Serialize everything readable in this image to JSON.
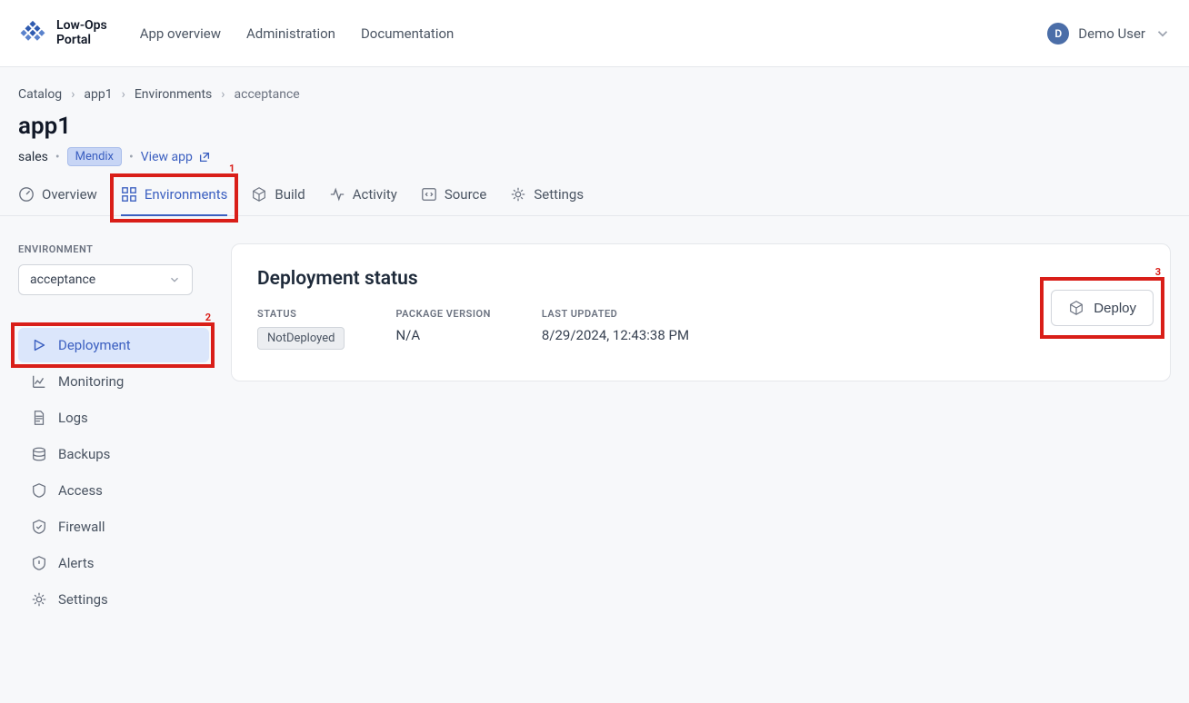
{
  "header": {
    "logo_line1": "Low-Ops",
    "logo_line2": "Portal",
    "nav": [
      "App overview",
      "Administration",
      "Documentation"
    ],
    "user_initial": "D",
    "user_name": "Demo User"
  },
  "breadcrumb": [
    "Catalog",
    "app1",
    "Environments",
    "acceptance"
  ],
  "page_title": "app1",
  "subline": {
    "team": "sales",
    "badge": "Mendix",
    "view_app": "View app"
  },
  "tabs": [
    "Overview",
    "Environments",
    "Build",
    "Activity",
    "Source",
    "Settings"
  ],
  "annotations": {
    "tab": "1",
    "side": "2",
    "deploy": "3"
  },
  "sidebar": {
    "label": "ENVIRONMENT",
    "selected": "acceptance",
    "items": [
      "Deployment",
      "Monitoring",
      "Logs",
      "Backups",
      "Access",
      "Firewall",
      "Alerts",
      "Settings"
    ]
  },
  "card": {
    "title": "Deployment status",
    "cols": {
      "status_label": "STATUS",
      "status_value": "NotDeployed",
      "pkg_label": "PACKAGE VERSION",
      "pkg_value": "N/A",
      "updated_label": "LAST UPDATED",
      "updated_value": "8/29/2024, 12:43:38 PM"
    },
    "deploy_btn": "Deploy"
  }
}
